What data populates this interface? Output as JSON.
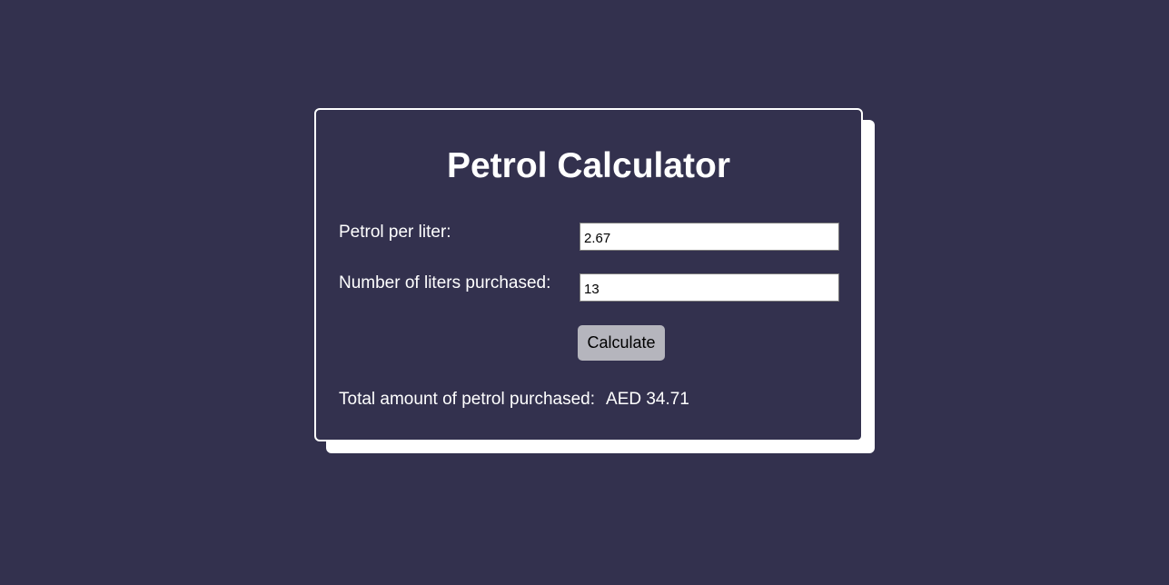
{
  "page": {
    "background_color": "#33314e",
    "accent_color": "#ffffff",
    "button_color": "#b5b5bd"
  },
  "calculator": {
    "title": "Petrol Calculator",
    "price_label": "Petrol per liter:",
    "price_value": "2.67",
    "liters_label": "Number of liters purchased:",
    "liters_value": "13",
    "calculate_label": "Calculate",
    "result_label": "Total amount of petrol purchased:",
    "result_value": "AED 34.71"
  }
}
